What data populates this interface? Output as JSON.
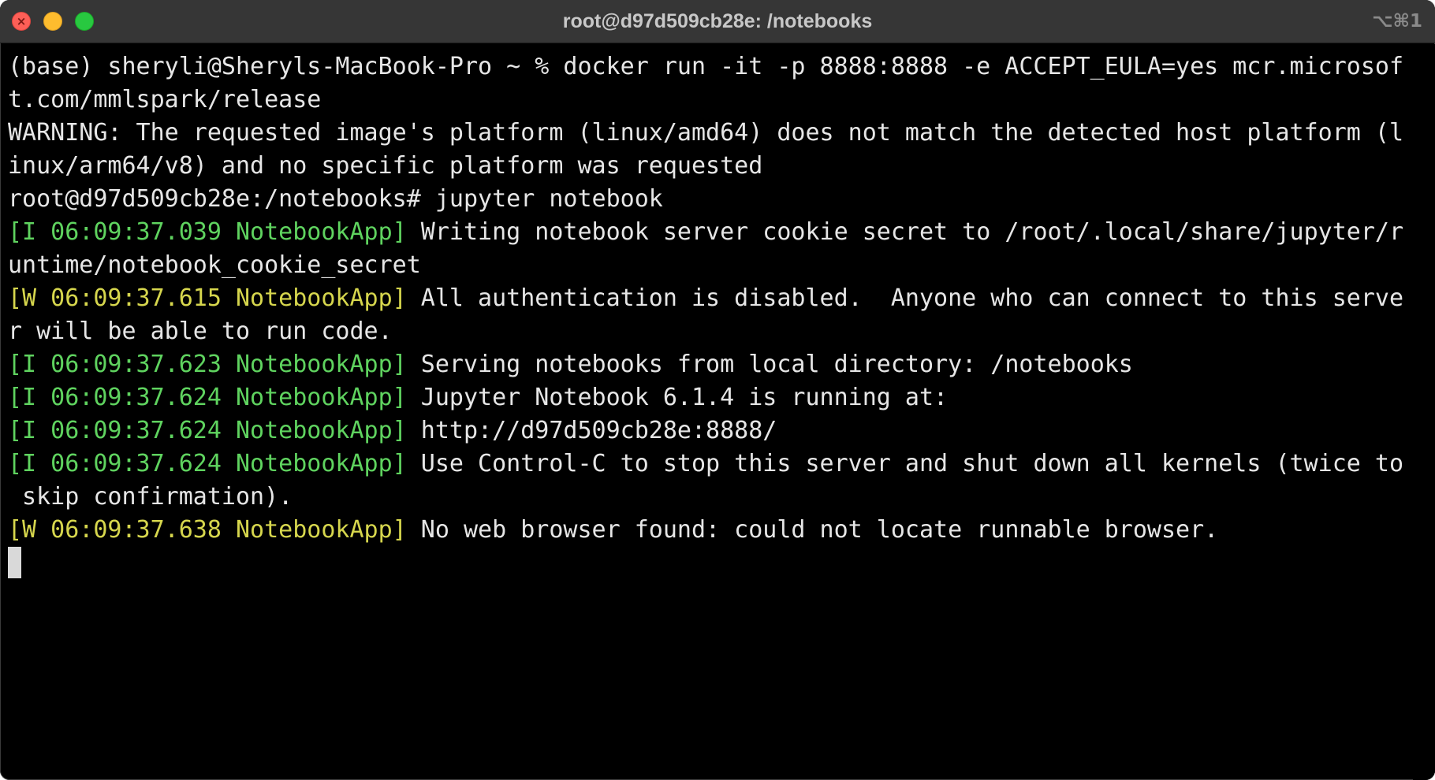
{
  "window": {
    "title": "root@d97d509cb28e: /notebooks",
    "shortcut": "⌥⌘1"
  },
  "colors": {
    "background": "#000000",
    "text": "#e6e6e6",
    "info_tag": "#5fd35f",
    "warn_tag": "#d6d64d",
    "titlebar": "#363636"
  },
  "terminal": {
    "lines": [
      {
        "tag": "",
        "text": "(base) sheryli@Sheryls-MacBook-Pro ~ % docker run -it -p 8888:8888 -e ACCEPT_EULA=yes mcr.microsof"
      },
      {
        "tag": "",
        "text": "t.com/mmlspark/release"
      },
      {
        "tag": "",
        "text": "WARNING: The requested image's platform (linux/amd64) does not match the detected host platform (l"
      },
      {
        "tag": "",
        "text": "inux/arm64/v8) and no specific platform was requested"
      },
      {
        "tag": "",
        "text": "root@d97d509cb28e:/notebooks# jupyter notebook"
      },
      {
        "tag": "[I 06:09:37.039 NotebookApp]",
        "text": " Writing notebook server cookie secret to /root/.local/share/jupyter/r"
      },
      {
        "tag": "",
        "text": "untime/notebook_cookie_secret"
      },
      {
        "tag": "[W 06:09:37.615 NotebookApp]",
        "text": " All authentication is disabled.  Anyone who can connect to this serve"
      },
      {
        "tag": "",
        "text": "r will be able to run code."
      },
      {
        "tag": "[I 06:09:37.623 NotebookApp]",
        "text": " Serving notebooks from local directory: /notebooks"
      },
      {
        "tag": "[I 06:09:37.624 NotebookApp]",
        "text": " Jupyter Notebook 6.1.4 is running at:"
      },
      {
        "tag": "[I 06:09:37.624 NotebookApp]",
        "text": " http://d97d509cb28e:8888/"
      },
      {
        "tag": "[I 06:09:37.624 NotebookApp]",
        "text": " Use Control-C to stop this server and shut down all kernels (twice to"
      },
      {
        "tag": "",
        "text": " skip confirmation)."
      },
      {
        "tag": "[W 06:09:37.638 NotebookApp]",
        "text": " No web browser found: could not locate runnable browser."
      }
    ]
  }
}
